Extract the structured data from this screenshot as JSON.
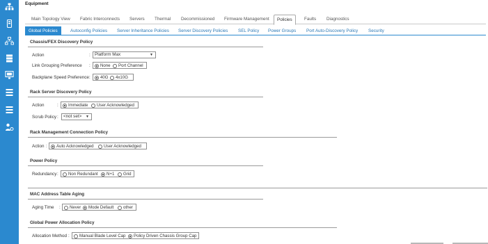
{
  "sidebar": {
    "icons": [
      "network-icon",
      "server-icon",
      "topology-icon",
      "storage-icon",
      "monitor-icon",
      "list-icon",
      "list-icon",
      "admin-icon"
    ]
  },
  "header": {
    "title": "Equipment"
  },
  "main_tabs": [
    {
      "label": "Main Topology View",
      "active": false
    },
    {
      "label": "Fabric Interconnects",
      "active": false
    },
    {
      "label": "Servers",
      "active": false
    },
    {
      "label": "Thermal",
      "active": false
    },
    {
      "label": "Decommissioned",
      "active": false
    },
    {
      "label": "Firmware Management",
      "active": false
    },
    {
      "label": "Policies",
      "active": true
    },
    {
      "label": "Faults",
      "active": false
    },
    {
      "label": "Diagnostics",
      "active": false
    }
  ],
  "sub_tabs": [
    {
      "label": "Global Policies",
      "active": true
    },
    {
      "label": "Autoconfig Policies",
      "active": false
    },
    {
      "label": "Server Inheritance Policies",
      "active": false
    },
    {
      "label": "Server Discovery Policies",
      "active": false
    },
    {
      "label": "SEL Policy",
      "active": false
    },
    {
      "label": "Power Groups",
      "active": false
    },
    {
      "label": "Port Auto-Discovery Policy",
      "active": false
    },
    {
      "label": "Security",
      "active": false
    }
  ],
  "chassis_fex": {
    "title": "Chassis/FEX Discovery Policy",
    "action_label": "Action",
    "action_value": "Platform Max",
    "link_grouping_label": "Link Grouping Preference",
    "link_grouping_options": [
      "None",
      "Port Channel"
    ],
    "backplane_label": "Backplane Speed Preference",
    "backplane_options": [
      "40G",
      "4x10G"
    ]
  },
  "rack_server": {
    "title": "Rack Server Discovery Policy",
    "action_label": "Action",
    "action_options": [
      "Immediate",
      "User Acknowledged"
    ],
    "scrub_label": "Scrub Policy",
    "scrub_value": "<not set>"
  },
  "rack_mgmt": {
    "title": "Rack Management Connection Policy",
    "action_label": "Action",
    "action_options": [
      "Auto Acknowledged",
      "User Acknowledged"
    ]
  },
  "power_policy": {
    "title": "Power Policy",
    "redundancy_label": "Redundancy",
    "redundancy_options": [
      "Non Redundant",
      "N+1",
      "Grid"
    ]
  },
  "mac_aging": {
    "title": "MAC Address Table Aging",
    "aging_label": "Aging Time",
    "aging_options": [
      "Never",
      "Mode Default",
      "other"
    ]
  },
  "global_power": {
    "title": "Global Power Allocation Policy",
    "method_label": "Allocation Method",
    "method_options": [
      "Manual Blade Level Cap",
      "Policy Driven Chassis Group Cap"
    ]
  },
  "colors": {
    "accent": "#2b89cf",
    "sidebar": "#2b89cf"
  }
}
